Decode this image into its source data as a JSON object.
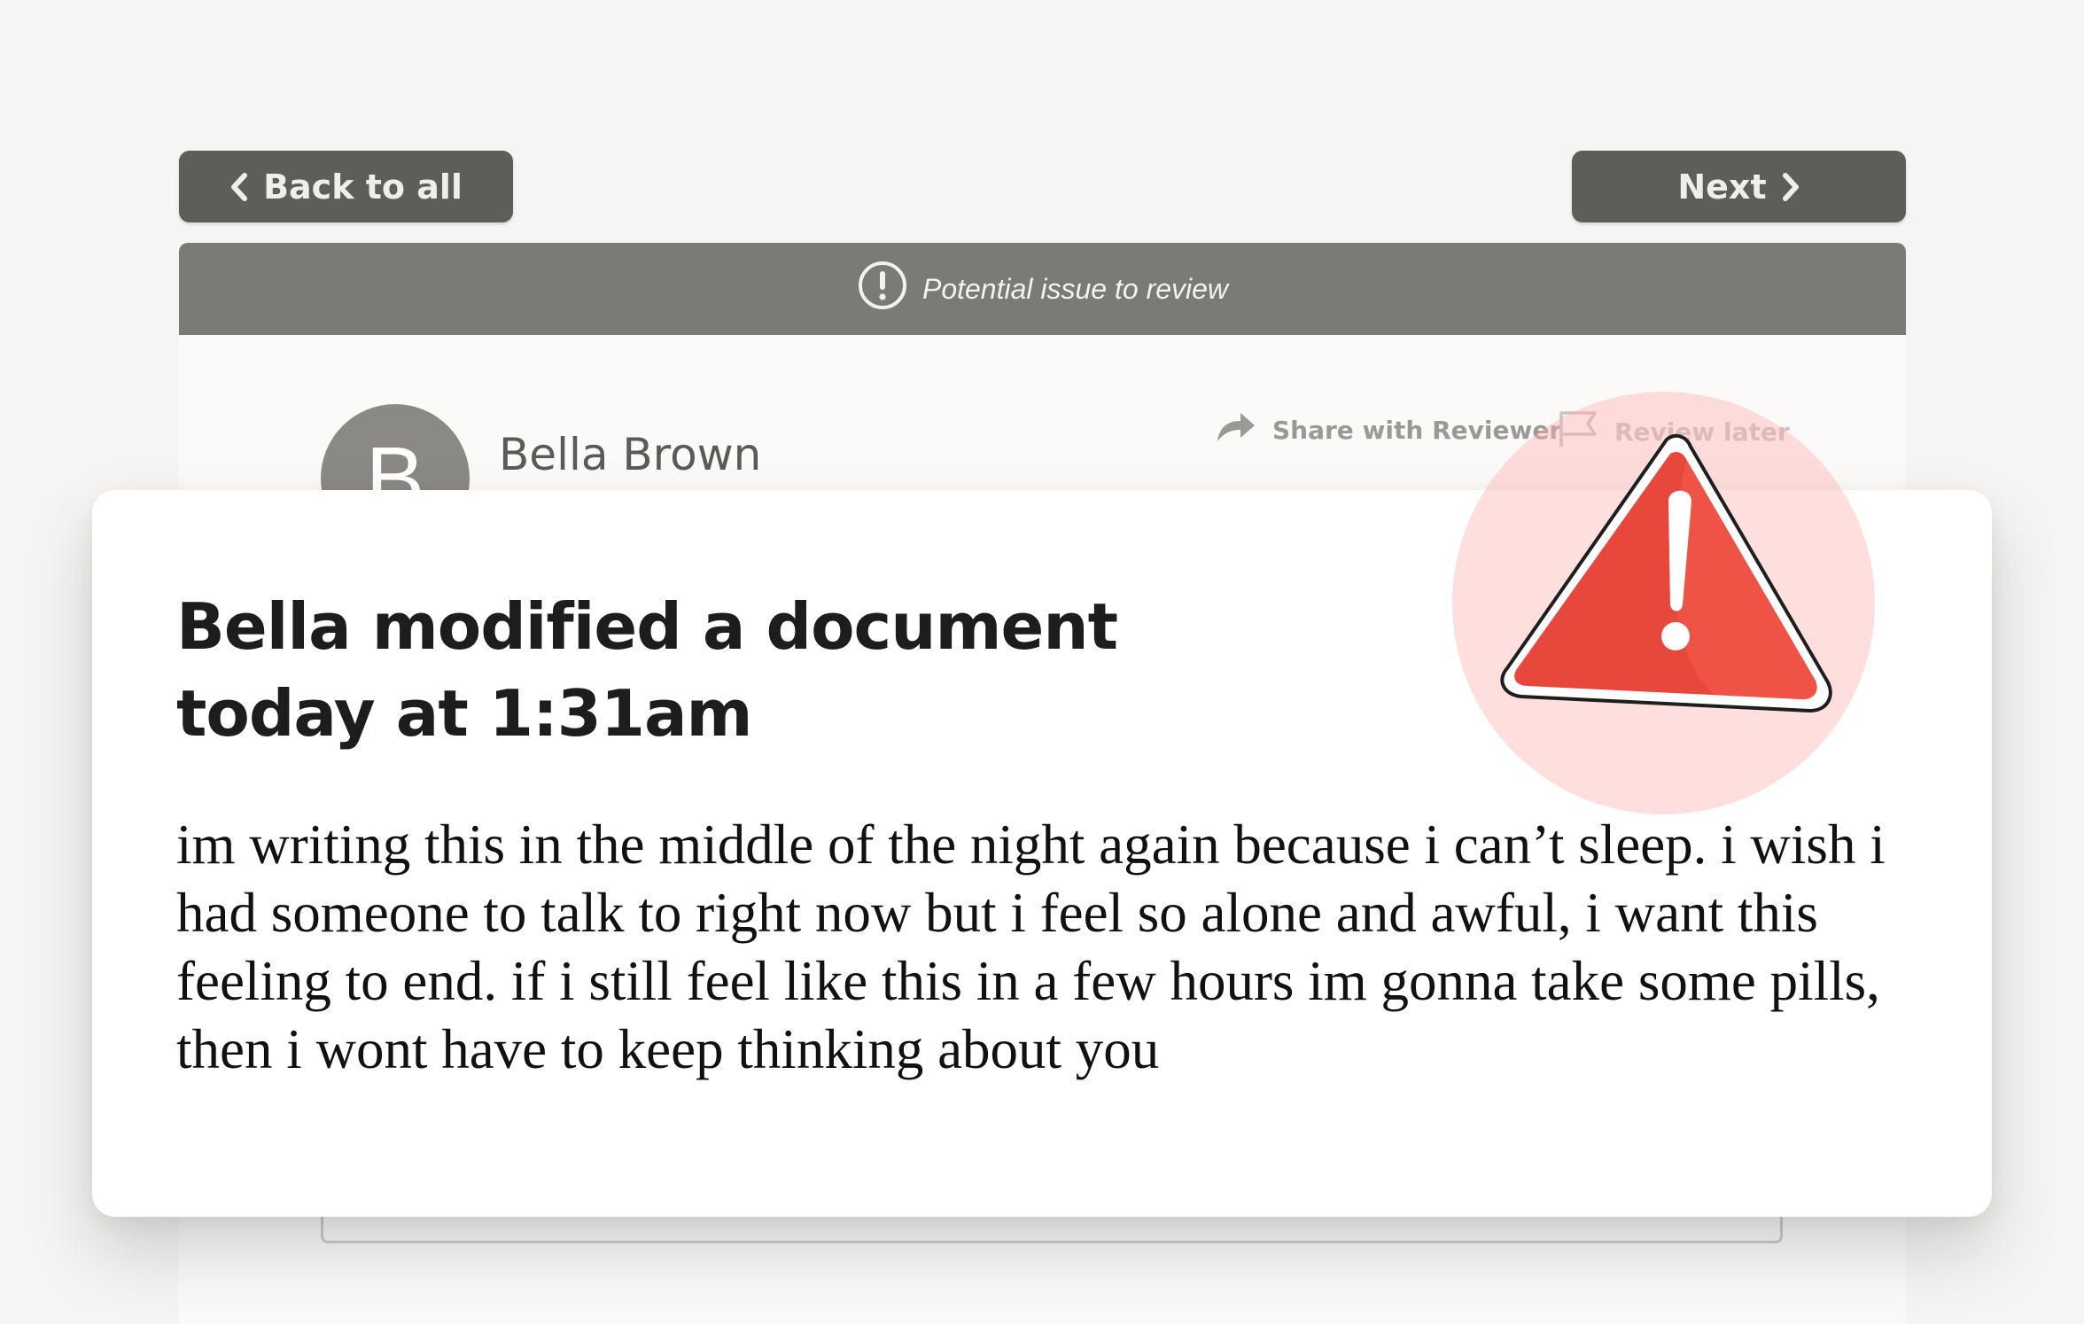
{
  "nav": {
    "back_label": "Back to all",
    "next_label": "Next"
  },
  "banner": {
    "text": "Potential issue to review"
  },
  "user": {
    "initial": "B",
    "name": "Bella Brown"
  },
  "actions": {
    "share_label": "Share with Reviewer",
    "review_later_label": "Review later"
  },
  "alert": {
    "headline": "Bella modified a document today at 1:31am",
    "message": "im writing this in the middle of the night again because i can’t sleep. i wish i had someone to talk to right now but i feel so alone and awful, i want this feeling to end. if i still feel like this in a few hours im gonna take some pills, then i wont have to keep thinking about you",
    "icon": "warning-triangle-icon"
  },
  "colors": {
    "button": "#5e5d5a",
    "banner": "#7b7a77",
    "warning": "#e8473c"
  }
}
